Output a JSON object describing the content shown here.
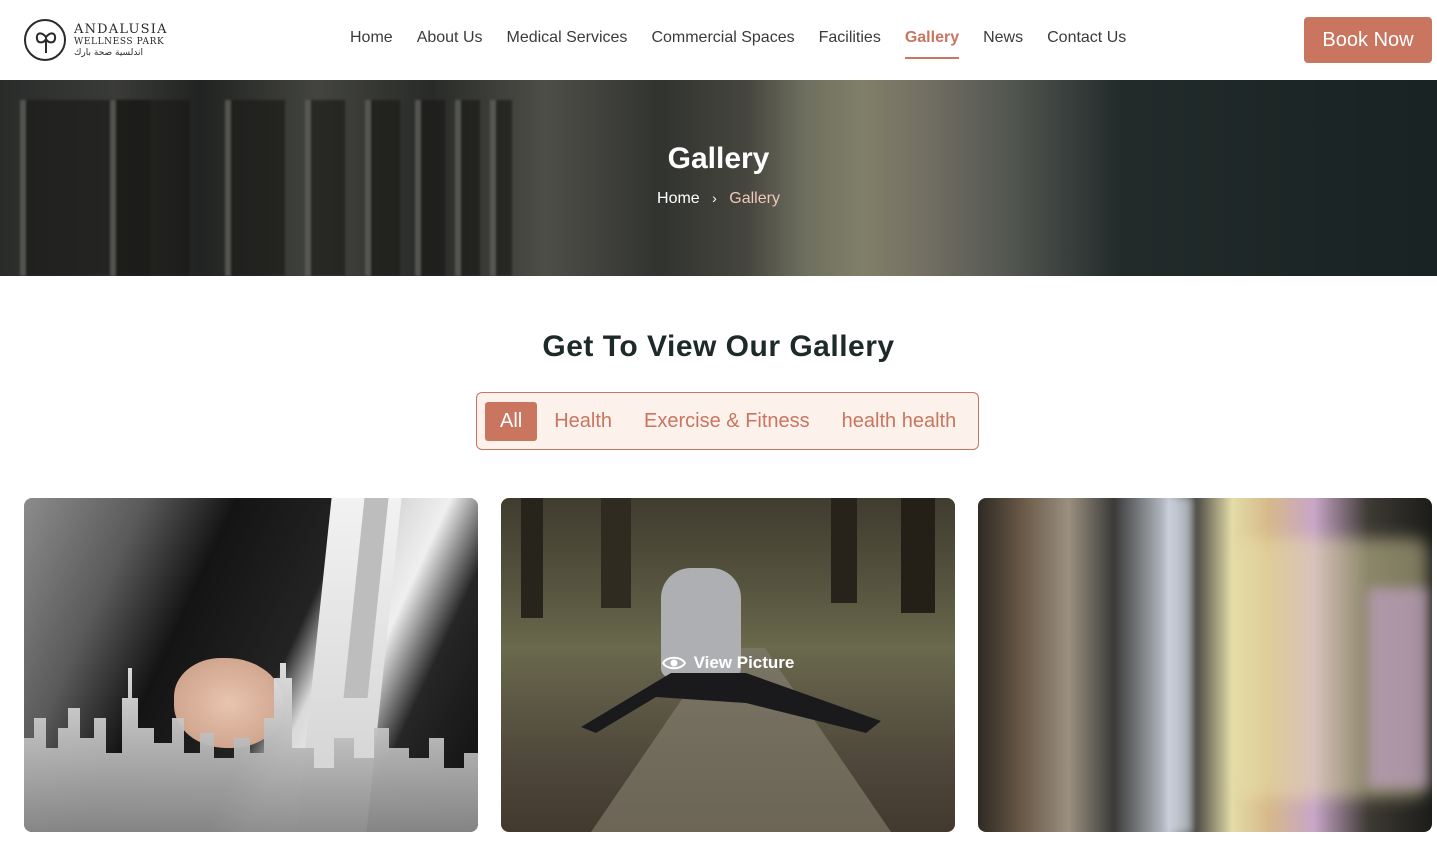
{
  "header": {
    "logo": {
      "line1": "ANDALUSIA",
      "line2": "WELLNESS PARK",
      "line3": "اندلسية صحة بارك"
    },
    "nav": [
      {
        "label": "Home",
        "active": false
      },
      {
        "label": "About Us",
        "active": false
      },
      {
        "label": "Medical Services",
        "active": false
      },
      {
        "label": "Commercial Spaces",
        "active": false
      },
      {
        "label": "Facilities",
        "active": false
      },
      {
        "label": "Gallery",
        "active": true
      },
      {
        "label": "News",
        "active": false
      },
      {
        "label": "Contact Us",
        "active": false
      }
    ],
    "book_label": "Book Now"
  },
  "hero": {
    "title": "Gallery",
    "breadcrumb": {
      "home": "Home",
      "separator": "›",
      "current": "Gallery"
    }
  },
  "gallery": {
    "heading": "Get To View Our Gallery",
    "filters": [
      {
        "label": "All",
        "active": true
      },
      {
        "label": "Health",
        "active": false
      },
      {
        "label": "Exercise & Fitness",
        "active": false
      },
      {
        "label": "health health",
        "active": false
      }
    ],
    "view_label": "View Picture",
    "items": [
      {
        "name": "businessman-city-image"
      },
      {
        "name": "park-stretching-image"
      },
      {
        "name": "blurred-gallery-image"
      }
    ]
  },
  "colors": {
    "accent": "#c97560",
    "accent_light": "#fdf1ec",
    "dark_text": "#1e2a2a"
  }
}
